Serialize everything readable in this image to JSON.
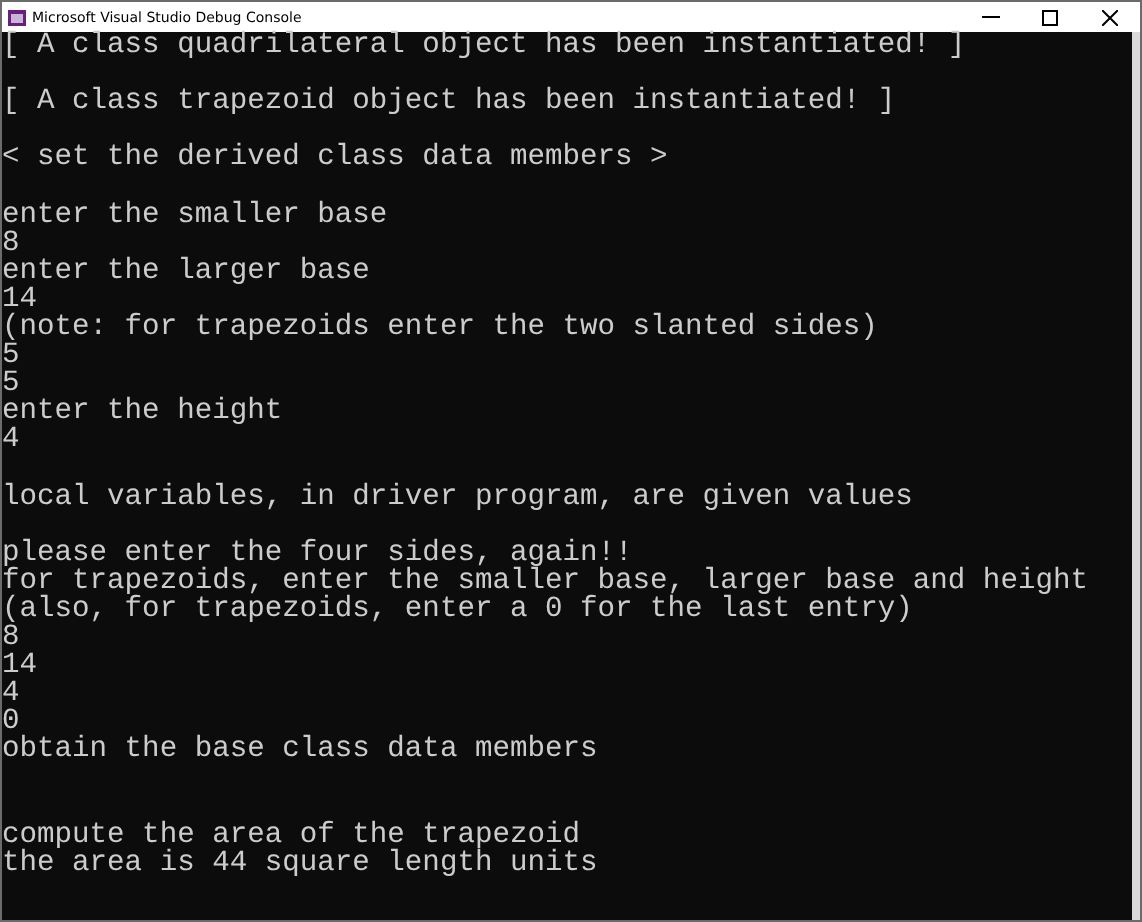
{
  "window": {
    "title": "Microsoft Visual Studio Debug Console"
  },
  "console": {
    "lines": [
      {
        "kind": "text",
        "text": "[ A class quadrilateral object has been instantiated! ]"
      },
      {
        "kind": "blank"
      },
      {
        "kind": "text",
        "text": "[ A class trapezoid object has been instantiated! ]"
      },
      {
        "kind": "blank"
      },
      {
        "kind": "text",
        "text": "< set the derived class data members >"
      },
      {
        "kind": "blank"
      },
      {
        "kind": "text",
        "text": "enter the smaller base"
      },
      {
        "kind": "text",
        "text": "8"
      },
      {
        "kind": "text",
        "text": "enter the larger base"
      },
      {
        "kind": "text",
        "text": "14"
      },
      {
        "kind": "text",
        "text": "(note: for trapezoids enter the two slanted sides)"
      },
      {
        "kind": "text",
        "text": "5"
      },
      {
        "kind": "text",
        "text": "5"
      },
      {
        "kind": "text",
        "text": "enter the height"
      },
      {
        "kind": "text",
        "text": "4"
      },
      {
        "kind": "blank"
      },
      {
        "kind": "text",
        "text": "local variables, in driver program, are given values"
      },
      {
        "kind": "blank"
      },
      {
        "kind": "text",
        "text": "please enter the four sides, again!!"
      },
      {
        "kind": "text",
        "text": "for trapezoids, enter the smaller base, larger base and height"
      },
      {
        "kind": "text",
        "text": "(also, for trapezoids, enter a 0 for the last entry)"
      },
      {
        "kind": "text",
        "text": "8"
      },
      {
        "kind": "text",
        "text": "14"
      },
      {
        "kind": "text",
        "text": "4"
      },
      {
        "kind": "text",
        "text": "0"
      },
      {
        "kind": "text",
        "text": "obtain the base class data members"
      },
      {
        "kind": "blank"
      },
      {
        "kind": "blank"
      },
      {
        "kind": "text",
        "text": "compute the area of the trapezoid"
      },
      {
        "kind": "text",
        "text": "the area is 44 square length units"
      }
    ]
  }
}
